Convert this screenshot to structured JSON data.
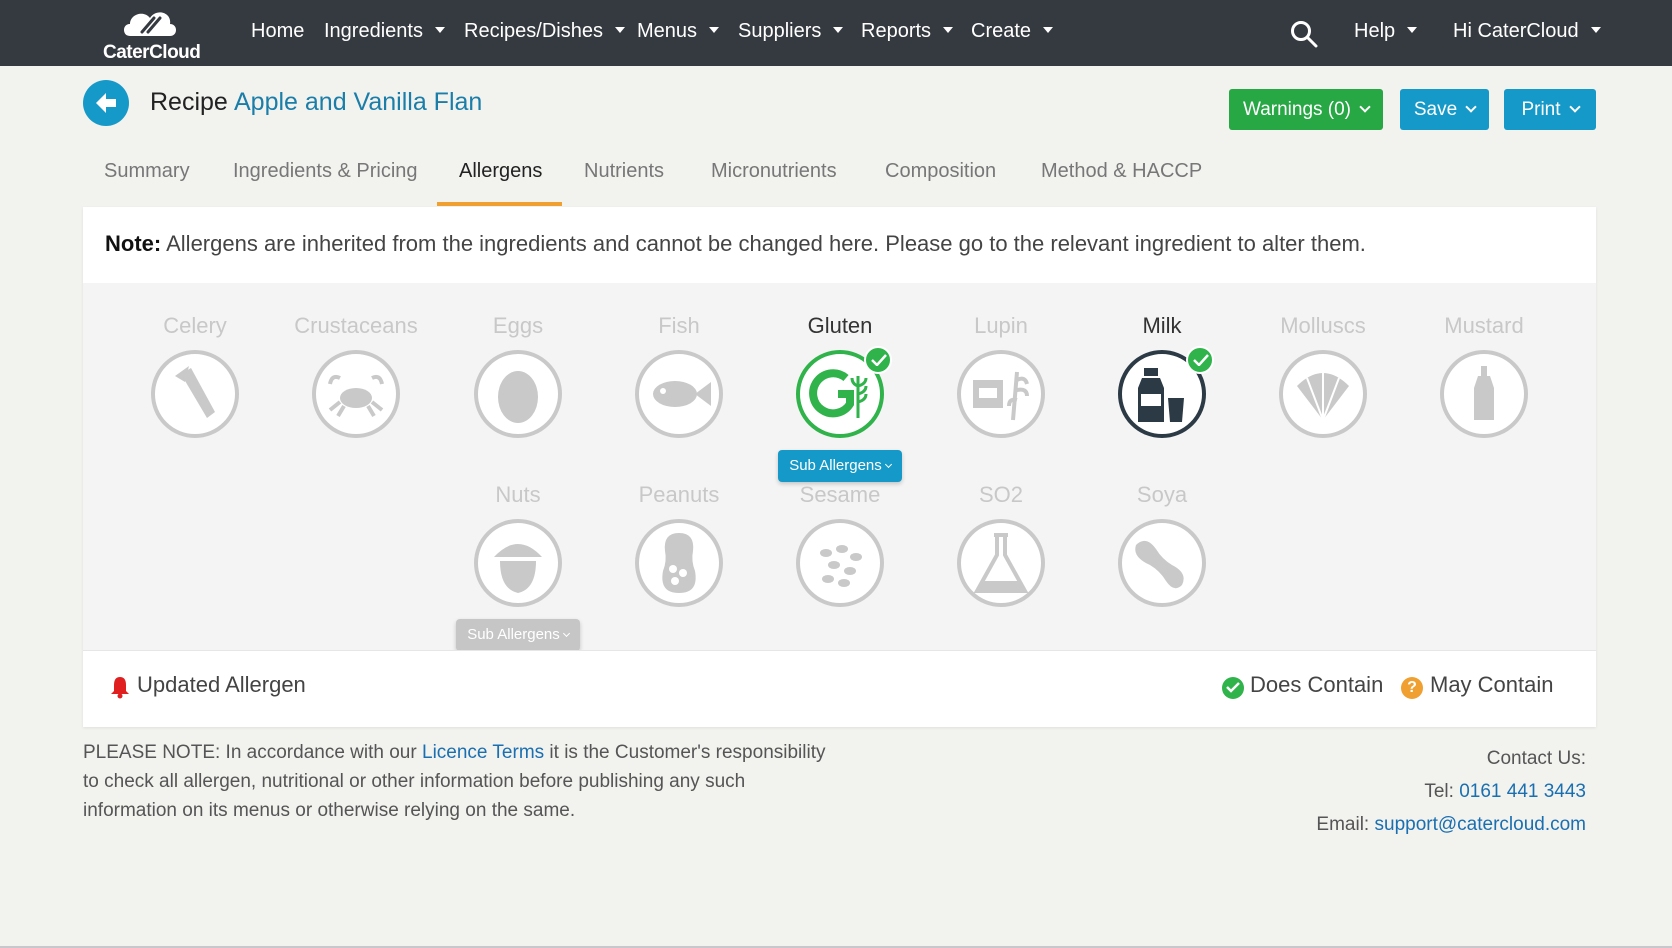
{
  "nav": {
    "brand": "CaterCloud",
    "items": [
      {
        "label": "Home",
        "dropdown": false
      },
      {
        "label": "Ingredients",
        "dropdown": true
      },
      {
        "label": "Recipes/Dishes",
        "dropdown": true
      },
      {
        "label": "Menus",
        "dropdown": true
      },
      {
        "label": "Suppliers",
        "dropdown": true
      },
      {
        "label": "Reports",
        "dropdown": true
      },
      {
        "label": "Create",
        "dropdown": true
      }
    ],
    "help": "Help",
    "user": "Hi CaterCloud"
  },
  "header": {
    "label": "Recipe",
    "name": "Apple and Vanilla Flan",
    "warnings": "Warnings (0)",
    "save": "Save",
    "print": "Print"
  },
  "tabs": [
    {
      "label": "Summary",
      "active": false
    },
    {
      "label": "Ingredients & Pricing",
      "active": false
    },
    {
      "label": "Allergens",
      "active": true
    },
    {
      "label": "Nutrients",
      "active": false
    },
    {
      "label": "Micronutrients",
      "active": false
    },
    {
      "label": "Composition",
      "active": false
    },
    {
      "label": "Method & HACCP",
      "active": false
    }
  ],
  "note": {
    "prefix": "Note:",
    "text": " Allergens are inherited from the ingredients and cannot be changed here. Please go to the relevant ingredient to alter them."
  },
  "allergens": [
    {
      "name": "Celery",
      "icon": "celery-icon",
      "contains": false,
      "sub_allergens": false
    },
    {
      "name": "Crustaceans",
      "icon": "crab-icon",
      "contains": false,
      "sub_allergens": false
    },
    {
      "name": "Eggs",
      "icon": "egg-icon",
      "contains": false,
      "sub_allergens": false
    },
    {
      "name": "Fish",
      "icon": "fish-icon",
      "contains": false,
      "sub_allergens": false
    },
    {
      "name": "Gluten",
      "icon": "gluten-icon",
      "contains": true,
      "sub_allergens": true
    },
    {
      "name": "Lupin",
      "icon": "lupin-icon",
      "contains": false,
      "sub_allergens": false
    },
    {
      "name": "Milk",
      "icon": "milk-icon",
      "contains": true,
      "sub_allergens": false
    },
    {
      "name": "Molluscs",
      "icon": "shell-icon",
      "contains": false,
      "sub_allergens": false
    },
    {
      "name": "Mustard",
      "icon": "mustard-icon",
      "contains": false,
      "sub_allergens": false
    },
    {
      "name": "Nuts",
      "icon": "acorn-icon",
      "contains": false,
      "sub_allergens": true
    },
    {
      "name": "Peanuts",
      "icon": "peanut-icon",
      "contains": false,
      "sub_allergens": false
    },
    {
      "name": "Sesame",
      "icon": "sesame-icon",
      "contains": false,
      "sub_allergens": false
    },
    {
      "name": "SO2",
      "icon": "flask-icon",
      "contains": false,
      "sub_allergens": false
    },
    {
      "name": "Soya",
      "icon": "soya-icon",
      "contains": false,
      "sub_allergens": false
    }
  ],
  "sub_allergens_label": "Sub Allergens",
  "legend": {
    "updated": "Updated Allergen",
    "does_contain": "Does Contain",
    "may_contain": "May Contain"
  },
  "footer": {
    "disclaimer_pre": "PLEASE NOTE: In accordance with our ",
    "licence_link": "Licence Terms",
    "disclaimer_post": " it is the Customer's responsibility to check all allergen, nutritional or other information before publishing any such information on its menus or otherwise relying on the same.",
    "contact_title": "Contact Us:",
    "tel_label": "Tel: ",
    "tel": "0161 441 3443",
    "email_label": "Email: ",
    "email": "support@catercloud.com"
  },
  "colors": {
    "navbar": "#353a40",
    "primary": "#1599c8",
    "success": "#28a745",
    "tab_accent": "#f0a030",
    "bell": "#e02020"
  }
}
